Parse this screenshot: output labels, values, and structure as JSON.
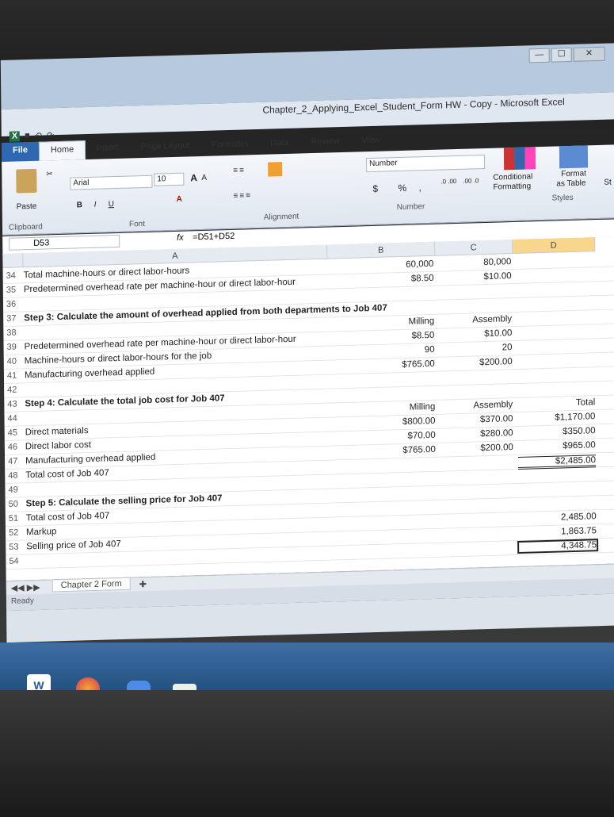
{
  "window": {
    "title": "Chapter_2_Applying_Excel_Student_Form HW - Copy - Microsoft Excel",
    "controls": {
      "minimize": "—",
      "maximize": "☐",
      "close": "✕"
    }
  },
  "qat": {
    "save_icon": "save-icon",
    "undo": "↶",
    "redo": "↷"
  },
  "tabs": [
    "File",
    "Home",
    "Insert",
    "Page Layout",
    "Formulas",
    "Data",
    "Review",
    "View"
  ],
  "ribbon": {
    "clipboard": {
      "paste": "Paste",
      "label": "Clipboard"
    },
    "font": {
      "name": "Arial",
      "size": "10",
      "grow": "A",
      "shrink": "A",
      "bold": "B",
      "italic": "I",
      "underline": "U",
      "label": "Font"
    },
    "alignment": {
      "label": "Alignment"
    },
    "number": {
      "format": "Number",
      "currency": "$",
      "percent": "%",
      "comma": ",",
      "inc_dec": ".0 .00",
      "dec_dec": ".00 .0",
      "label": "Number"
    },
    "styles": {
      "conditional": "Conditional",
      "formatting": "Formatting",
      "format": "Format",
      "as_table": "as Table",
      "cell_styles": "St",
      "label": "Styles"
    }
  },
  "formula_bar": {
    "name_box": "D53",
    "fx": "fx",
    "formula": "=D51+D52"
  },
  "columns": [
    "A",
    "B",
    "C",
    "D"
  ],
  "rows": [
    {
      "n": "34",
      "a": "Total machine-hours or direct labor-hours",
      "b": "60,000",
      "c": "80,000",
      "d": ""
    },
    {
      "n": "35",
      "a": "Predetermined overhead rate per machine-hour or direct labor-hour",
      "b": "$8.50",
      "c": "$10.00",
      "d": ""
    },
    {
      "n": "36",
      "a": "",
      "b": "",
      "c": "",
      "d": ""
    },
    {
      "n": "37",
      "a": "Step 3: Calculate the amount of overhead applied from both departments to Job 407",
      "b": "",
      "c": "",
      "d": "",
      "bold": true
    },
    {
      "n": "38",
      "a": "",
      "b": "Milling",
      "c": "Assembly",
      "d": ""
    },
    {
      "n": "39",
      "a": "Predetermined overhead rate per machine-hour or direct labor-hour",
      "b": "$8.50",
      "c": "$10.00",
      "d": ""
    },
    {
      "n": "40",
      "a": "Machine-hours or direct labor-hours for the job",
      "b": "90",
      "c": "20",
      "d": ""
    },
    {
      "n": "41",
      "a": "Manufacturing overhead applied",
      "b": "$765.00",
      "c": "$200.00",
      "d": ""
    },
    {
      "n": "42",
      "a": "",
      "b": "",
      "c": "",
      "d": ""
    },
    {
      "n": "43",
      "a": "Step 4: Calculate the total job cost for Job 407",
      "b": "",
      "c": "",
      "d": "",
      "bold": true
    },
    {
      "n": "44",
      "a": "",
      "b": "Milling",
      "c": "Assembly",
      "d": "Total"
    },
    {
      "n": "45",
      "a": "Direct materials",
      "b": "$800.00",
      "c": "$370.00",
      "d": "$1,170.00"
    },
    {
      "n": "46",
      "a": "Direct labor cost",
      "b": "$70.00",
      "c": "$280.00",
      "d": "$350.00"
    },
    {
      "n": "47",
      "a": "Manufacturing overhead applied",
      "b": "$765.00",
      "c": "$200.00",
      "d": "$965.00"
    },
    {
      "n": "48",
      "a": "Total cost of Job 407",
      "b": "",
      "c": "",
      "d": "$2,485.00"
    },
    {
      "n": "49",
      "a": "",
      "b": "",
      "c": "",
      "d": ""
    },
    {
      "n": "50",
      "a": "Step 5: Calculate the selling price for Job 407",
      "b": "",
      "c": "",
      "d": "",
      "bold": true
    },
    {
      "n": "51",
      "a": "Total cost of Job 407",
      "b": "",
      "c": "",
      "d": ""
    },
    {
      "n": "52",
      "a": "Markup",
      "b": "",
      "c": "",
      "d": "2,485.00"
    },
    {
      "n": "53",
      "a": "Selling price of Job 407",
      "b": "",
      "c": "",
      "d": "1,863.75"
    },
    {
      "n": "54",
      "a": "",
      "b": "",
      "c": "",
      "d": "4,348.75"
    }
  ],
  "sheet_tab": "Chapter 2 Form",
  "status": "Ready",
  "taskbar": {
    "word": "W",
    "firefox": "firefox-icon",
    "zoom": "zoom-icon",
    "excel": "X"
  },
  "colors": {
    "accent": "#2f68b2",
    "selected_col": "#f8d78c",
    "taskbar": "#2b5b8f"
  }
}
